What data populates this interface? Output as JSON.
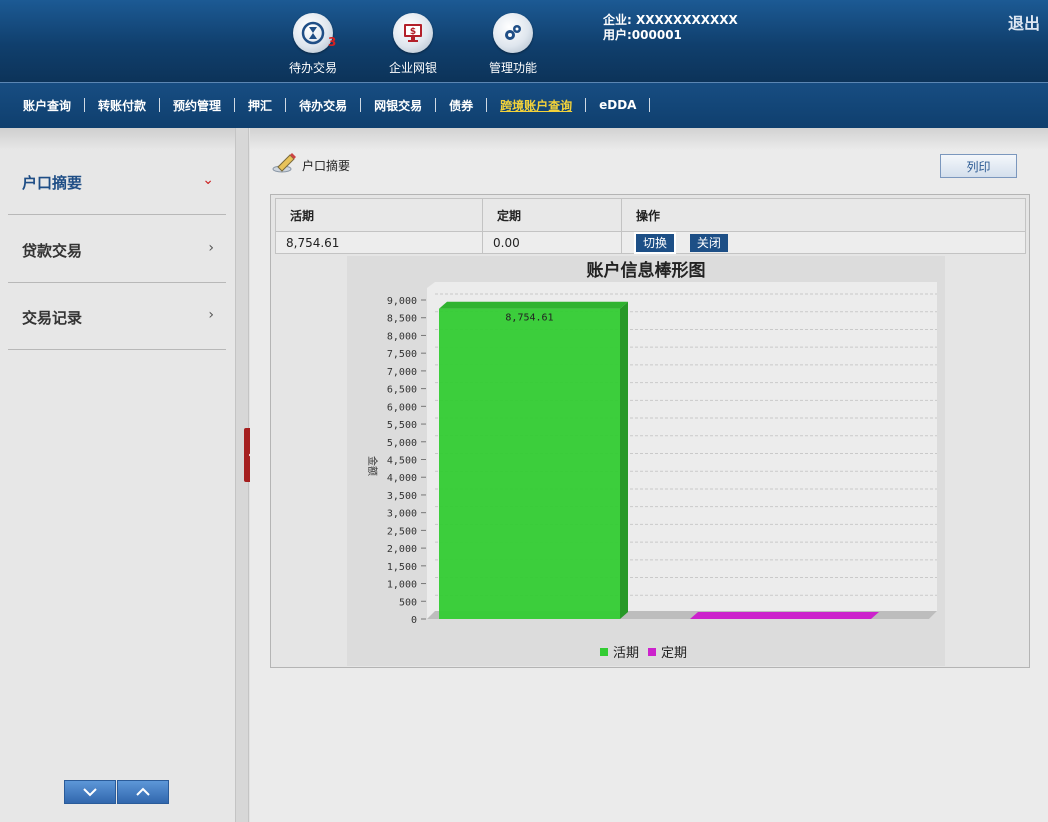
{
  "header": {
    "icons": [
      {
        "label": "待办交易",
        "badge": "3"
      },
      {
        "label": "企业网银"
      },
      {
        "label": "管理功能"
      }
    ],
    "company": "企业: XXXXXXXXXXX",
    "user": "用户:000001",
    "logout": "退出"
  },
  "nav": {
    "items": [
      "账户查询",
      "转账付款",
      "预约管理",
      "押汇",
      "待办交易",
      "网银交易",
      "债券",
      "跨境账户查询",
      "eDDA"
    ],
    "active_index": 7
  },
  "sidebar": {
    "items": [
      {
        "label": "户口摘要",
        "active": true
      },
      {
        "label": "贷款交易"
      },
      {
        "label": "交易记录"
      }
    ]
  },
  "page": {
    "title": "户口摘要",
    "print_label": "列印"
  },
  "table": {
    "headers": [
      "活期",
      "定期",
      "操作"
    ],
    "row": {
      "current": "8,754.61",
      "fixed": "0.00"
    },
    "switch_label": "切换",
    "close_label": "关闭"
  },
  "chart_data": {
    "type": "bar",
    "title": "账户信息棒形图",
    "categories": [
      "活期",
      "定期"
    ],
    "values": [
      8754.61,
      0
    ],
    "data_labels": [
      "8,754.61",
      ""
    ],
    "colors": [
      "#33cc33",
      "#cc22cc"
    ],
    "ylabel": "金额",
    "ylim": [
      0,
      9000
    ],
    "ytick_step": 500,
    "grid": true,
    "legend": "bottom"
  }
}
